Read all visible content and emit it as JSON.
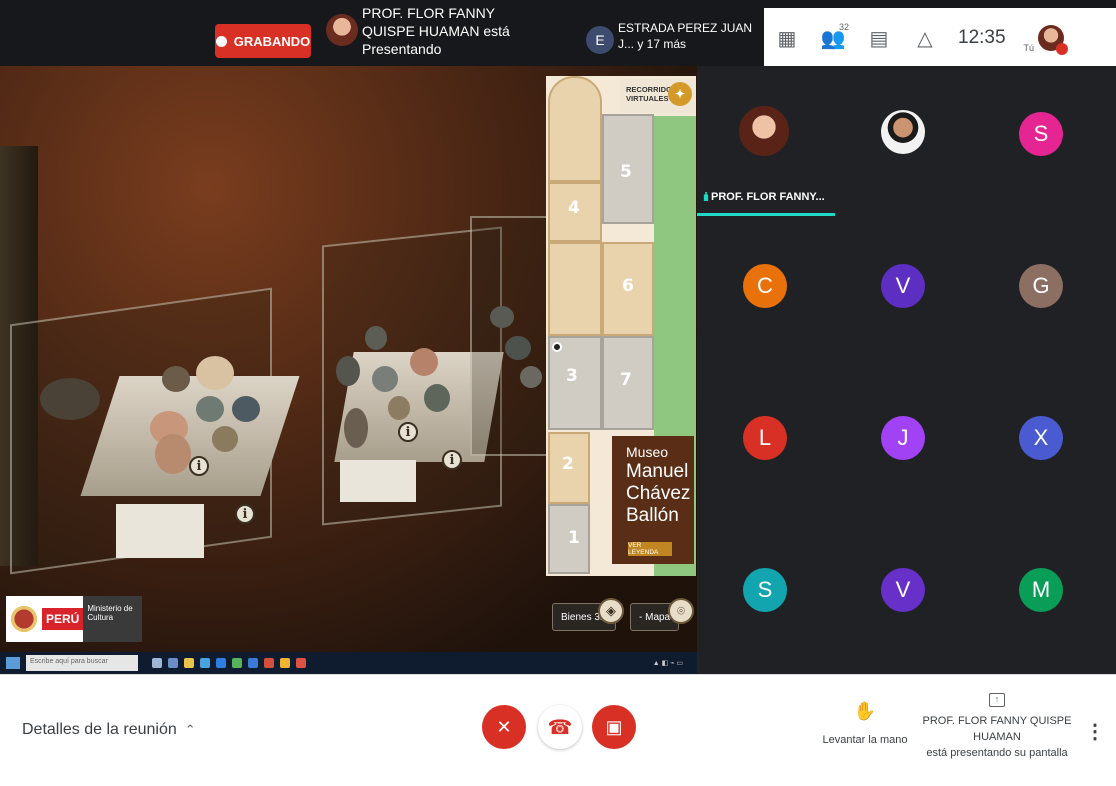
{
  "topbar": {
    "recording_label": "GRABANDO",
    "presenter_text": "PROF. FLOR FANNY QUISPE HUAMAN está Presentando",
    "participant_initial": "E",
    "participant_text": "ESTRADA PEREZ JUAN J... y 17 más",
    "people_count": "32",
    "time": "12:35",
    "self_label": "Tú"
  },
  "share": {
    "map": {
      "recorridos": "RECORRIDOS VIRTUALES",
      "rooms": [
        "1",
        "2",
        "3",
        "4",
        "5",
        "6",
        "7"
      ],
      "museo_line1": "Museo",
      "museo_line2": "Manuel",
      "museo_line3": "Chávez",
      "museo_line4": "Ballón",
      "ver_leyenda": "VER LEYENDA"
    },
    "peru_label": "PERÚ",
    "ministerio_label": "Ministerio de Cultura",
    "bienes_label": "Bienes 3D",
    "mapa_label": "- Mapa",
    "info_glyph": "i",
    "taskbar_search": "Escribe aquí para buscar"
  },
  "grid": {
    "speaking_name": "PROF. FLOR FANNY...",
    "tiles": [
      {
        "initial": "S",
        "color": "#e52592"
      },
      {
        "initial": "C",
        "color": "#e8710a"
      },
      {
        "initial": "V",
        "color": "#5c2fc2"
      },
      {
        "initial": "G",
        "color": "#8d6e63"
      },
      {
        "initial": "L",
        "color": "#d93025"
      },
      {
        "initial": "J",
        "color": "#a142f4"
      },
      {
        "initial": "X",
        "color": "#4a5bd1"
      },
      {
        "initial": "S",
        "color": "#12a4af"
      },
      {
        "initial": "V",
        "color": "#6630c9"
      },
      {
        "initial": "M",
        "color": "#0a9d58"
      }
    ]
  },
  "bottombar": {
    "details_label": "Detalles de la reunión",
    "raise_hand_label": "Levantar la mano",
    "presenting_line1": "PROF. FLOR FANNY QUISPE HUAMAN",
    "presenting_line2": "está presentando su pantalla"
  },
  "colors": {
    "meet_red": "#d93025",
    "speaking_teal": "#1ed9c3",
    "museum_brown": "#5a2d16"
  }
}
